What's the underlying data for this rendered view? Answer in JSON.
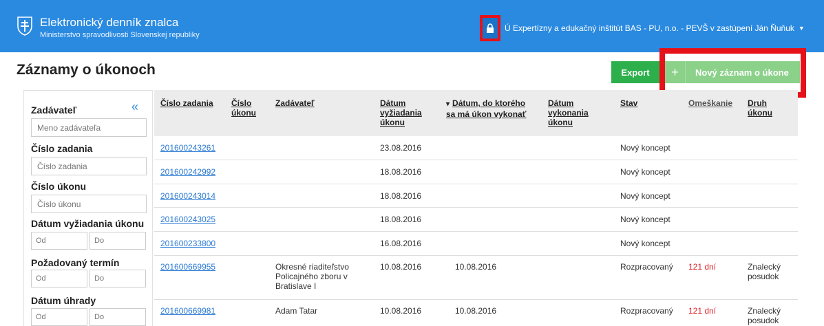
{
  "header": {
    "title": "Elektronický denník znalca",
    "subtitle": "Ministerstvo spravodlivosti Slovenskej republiky",
    "lock_icon": "lock-icon",
    "user": "Ú Expertízny a edukačný inštitút BAS - PU, n.o. - PEVŠ v zastúpení Ján Ňuňuk"
  },
  "page": {
    "title": "Záznamy o úkonoch",
    "export_label": "Export",
    "new_label": "Nový záznam o úkone",
    "new_icon": "+"
  },
  "filters": {
    "collapse_icon": "«",
    "zadavatel_label": "Zadávateľ",
    "zadavatel_placeholder": "Meno zadávateľa",
    "cislo_zadania_label": "Číslo zadania",
    "cislo_zadania_placeholder": "Číslo zadania",
    "cislo_ukonu_label": "Číslo úkonu",
    "cislo_ukonu_placeholder": "Číslo úkonu",
    "datum_vyziadania_label": "Dátum vyžiadania úkonu",
    "pozadovany_termin_label": "Požadovaný termín",
    "datum_uhrady_label": "Dátum úhrady",
    "od_placeholder": "Od",
    "do_placeholder": "Do"
  },
  "table": {
    "columns": {
      "cislo_zadania": "Číslo zadania",
      "cislo_ukonu": "Číslo úkonu",
      "zadavatel": "Zadávateľ",
      "datum_vyziadania": "Dátum vyžiadania úkonu",
      "datum_do": "Dátum, do ktorého sa má úkon vykonať",
      "datum_vykonania": "Dátum vykonania úkonu",
      "stav": "Stav",
      "omeskanie": "Omeškanie",
      "druh": "Druh úkonu"
    },
    "rows": [
      {
        "cislo": "201600243261",
        "zadavatel": "",
        "vyziadanie": "23.08.2016",
        "do": "",
        "stav": "Nový koncept",
        "omeskanie": "",
        "druh": ""
      },
      {
        "cislo": "201600242992",
        "zadavatel": "",
        "vyziadanie": "18.08.2016",
        "do": "",
        "stav": "Nový koncept",
        "omeskanie": "",
        "druh": ""
      },
      {
        "cislo": "201600243014",
        "zadavatel": "",
        "vyziadanie": "18.08.2016",
        "do": "",
        "stav": "Nový koncept",
        "omeskanie": "",
        "druh": ""
      },
      {
        "cislo": "201600243025",
        "zadavatel": "",
        "vyziadanie": "18.08.2016",
        "do": "",
        "stav": "Nový koncept",
        "omeskanie": "",
        "druh": ""
      },
      {
        "cislo": "201600233800",
        "zadavatel": "",
        "vyziadanie": "16.08.2016",
        "do": "",
        "stav": "Nový koncept",
        "omeskanie": "",
        "druh": ""
      },
      {
        "cislo": "201600669955",
        "zadavatel": "Okresné riaditeľstvo Policajného zboru v Bratislave I",
        "vyziadanie": "10.08.2016",
        "do": "10.08.2016",
        "stav": "Rozpracovaný",
        "omeskanie": "121 dní",
        "druh": "Znalecký posudok"
      },
      {
        "cislo": "201600669981",
        "zadavatel": "Adam Tatar",
        "vyziadanie": "10.08.2016",
        "do": "10.08.2016",
        "stav": "Rozpracovaný",
        "omeskanie": "121 dní",
        "druh": "Znalecký posudok"
      }
    ]
  },
  "colors": {
    "header": "#2a8ae0",
    "export": "#2db04b",
    "new": "#8bd189",
    "highlight": "#e5121a",
    "link": "#2a7ad4",
    "late": "#e0232a"
  }
}
